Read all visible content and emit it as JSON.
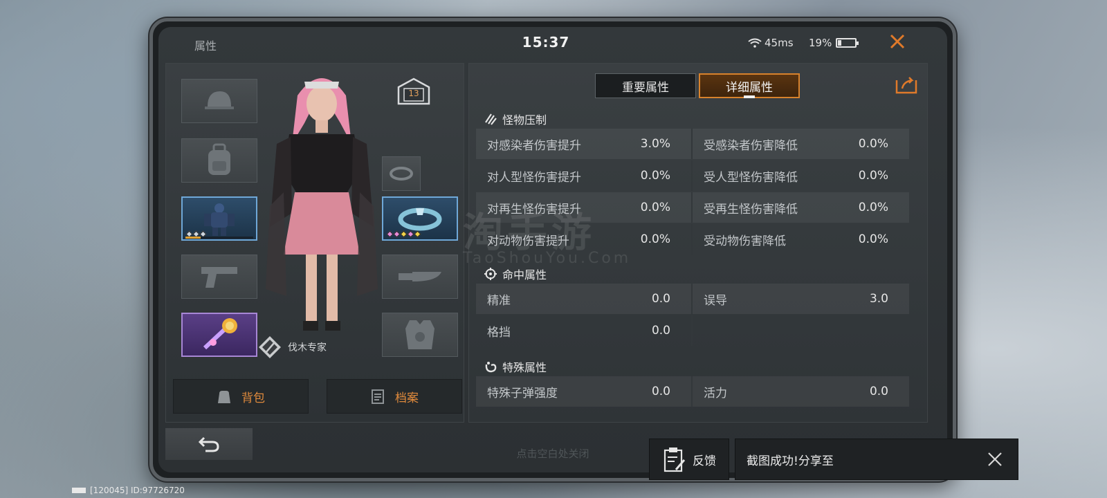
{
  "status": {
    "title": "属性",
    "time": "15:37",
    "ping": "45ms",
    "battery": "19%",
    "battery_level": 0.19
  },
  "character": {
    "level": "13",
    "title_badge": "伐木专家",
    "buttons": {
      "backpack": "背包",
      "profile": "档案"
    }
  },
  "tabs": {
    "main": "重要属性",
    "detail": "详细属性",
    "active": "detail"
  },
  "sections": {
    "monster": {
      "title": "怪物压制",
      "rows": [
        {
          "l_label": "对感染者伤害提升",
          "l_value": "3.0%",
          "r_label": "受感染者伤害降低",
          "r_value": "0.0%"
        },
        {
          "l_label": "对人型怪伤害提升",
          "l_value": "0.0%",
          "r_label": "受人型怪伤害降低",
          "r_value": "0.0%"
        },
        {
          "l_label": "对再生怪伤害提升",
          "l_value": "0.0%",
          "r_label": "受再生怪伤害降低",
          "r_value": "0.0%"
        },
        {
          "l_label": "对动物伤害提升",
          "l_value": "0.0%",
          "r_label": "受动物伤害降低",
          "r_value": "0.0%"
        }
      ]
    },
    "hit": {
      "title": "命中属性",
      "rows": [
        {
          "l_label": "精准",
          "l_value": "0.0",
          "r_label": "误导",
          "r_value": "3.0"
        },
        {
          "l_label": "格挡",
          "l_value": "0.0",
          "r_label": "",
          "r_value": ""
        }
      ]
    },
    "special": {
      "title": "特殊属性",
      "rows": [
        {
          "l_label": "特殊子弹强度",
          "l_value": "0.0",
          "r_label": "活力",
          "r_value": "0.0"
        }
      ]
    }
  },
  "hint": "点击空白处关闭",
  "watermark": {
    "main": "淘手游",
    "sub": "TaoShouYou.Com"
  },
  "feedback_label": "反馈",
  "toast_text": "截图成功!分享至",
  "footer_id": "[120045] ID:97726720",
  "colors": {
    "accent": "#e08a3c",
    "panel": "#33383b",
    "blue_rarity": "#6fa8d8",
    "purple_rarity": "#a887d6"
  }
}
